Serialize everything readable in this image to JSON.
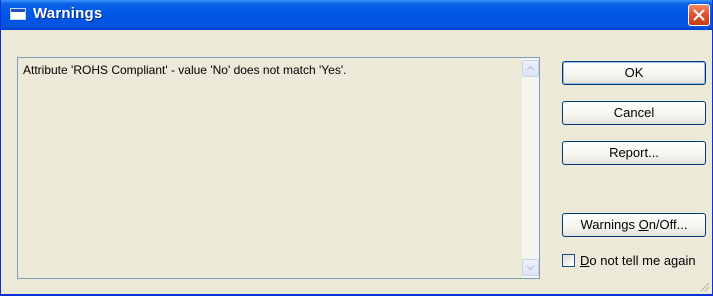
{
  "window": {
    "title": "Warnings"
  },
  "message": {
    "text": "Attribute 'ROHS Compliant' - value 'No' does not match 'Yes'."
  },
  "buttons": {
    "ok": "OK",
    "cancel": "Cancel",
    "report": "Report...",
    "warnings_pre": "Warnings ",
    "warnings_mnemonic": "O",
    "warnings_post": "n/Off..."
  },
  "checkbox": {
    "mnemonic": "D",
    "label_rest": "o not tell me again",
    "checked": false
  },
  "icons": [
    "window-icon",
    "close-icon",
    "scroll-up-icon",
    "scroll-down-icon",
    "resize-grip-icon"
  ],
  "colors": {
    "titlebar": "#0054e3",
    "close_button": "#e0532e",
    "dialog_background": "#ece9d8",
    "button_border": "#003c74"
  }
}
